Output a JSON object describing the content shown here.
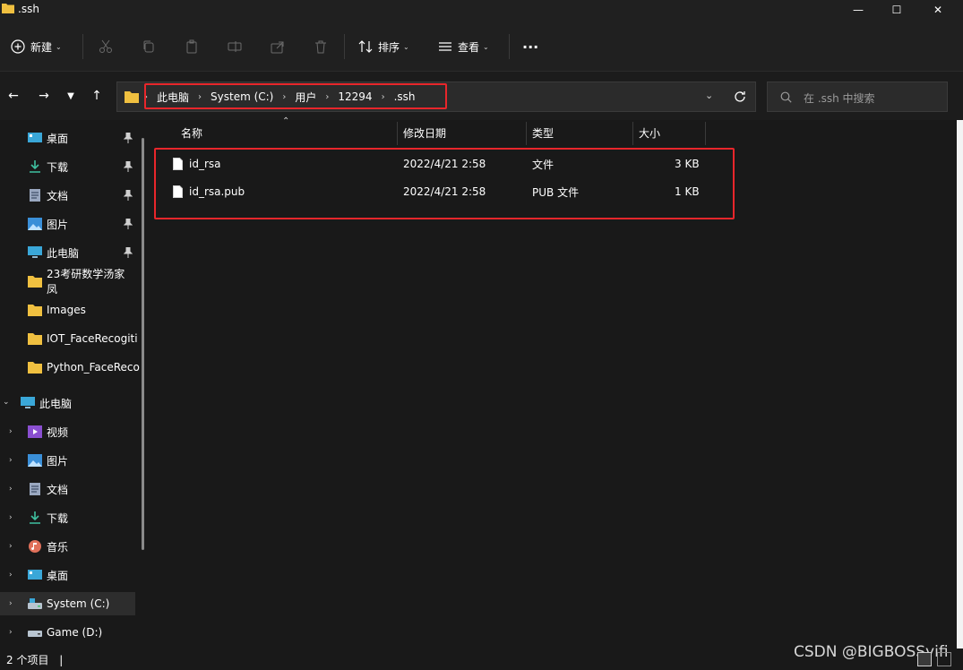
{
  "window": {
    "title": ".ssh",
    "minimize_glyph": "—",
    "maximize_glyph": "☐",
    "close_glyph": "✕"
  },
  "toolbar": {
    "new_label": "新建",
    "sort_label": "排序",
    "view_label": "查看",
    "more_glyph": "···"
  },
  "address": {
    "crumbs": [
      "此电脑",
      "System (C:)",
      "用户",
      "12294",
      ".ssh"
    ],
    "search_placeholder": "在 .ssh 中搜索"
  },
  "sidebar": {
    "quick": [
      {
        "label": "桌面",
        "icon": "desktop-icon",
        "pinned": true
      },
      {
        "label": "下载",
        "icon": "download-icon",
        "pinned": true
      },
      {
        "label": "文档",
        "icon": "document-icon",
        "pinned": true
      },
      {
        "label": "图片",
        "icon": "picture-icon",
        "pinned": true
      },
      {
        "label": "此电脑",
        "icon": "computer-icon",
        "pinned": true
      },
      {
        "label": "23考研数学汤家凤",
        "icon": "folder-icon"
      },
      {
        "label": "Images",
        "icon": "folder-icon"
      },
      {
        "label": "IOT_FaceRecogiti",
        "icon": "folder-icon"
      },
      {
        "label": "Python_FaceReco",
        "icon": "folder-icon"
      }
    ],
    "this_pc": {
      "label": "此电脑",
      "icon": "computer-icon"
    },
    "pc_children": [
      {
        "label": "视频",
        "icon": "video-icon"
      },
      {
        "label": "图片",
        "icon": "picture-icon"
      },
      {
        "label": "文档",
        "icon": "document-icon"
      },
      {
        "label": "下载",
        "icon": "download-icon"
      },
      {
        "label": "音乐",
        "icon": "music-icon"
      },
      {
        "label": "桌面",
        "icon": "desktop-icon"
      },
      {
        "label": "System (C:)",
        "icon": "drive-icon",
        "selected": true
      },
      {
        "label": "Game (D:)",
        "icon": "drive-icon"
      }
    ]
  },
  "table": {
    "columns": [
      "名称",
      "修改日期",
      "类型",
      "大小"
    ],
    "rows": [
      {
        "name": "id_rsa",
        "date": "2022/4/21 2:58",
        "type": "文件",
        "size": "3 KB"
      },
      {
        "name": "id_rsa.pub",
        "date": "2022/4/21 2:58",
        "type": "PUB 文件",
        "size": "1 KB"
      }
    ]
  },
  "status": {
    "count": "2 个项目",
    "separator": "|"
  },
  "watermark": "CSDN @BIGBOSSyifi",
  "colors": {
    "highlight": "#e8262b",
    "folder": "#f0c040",
    "background": "#191919"
  }
}
